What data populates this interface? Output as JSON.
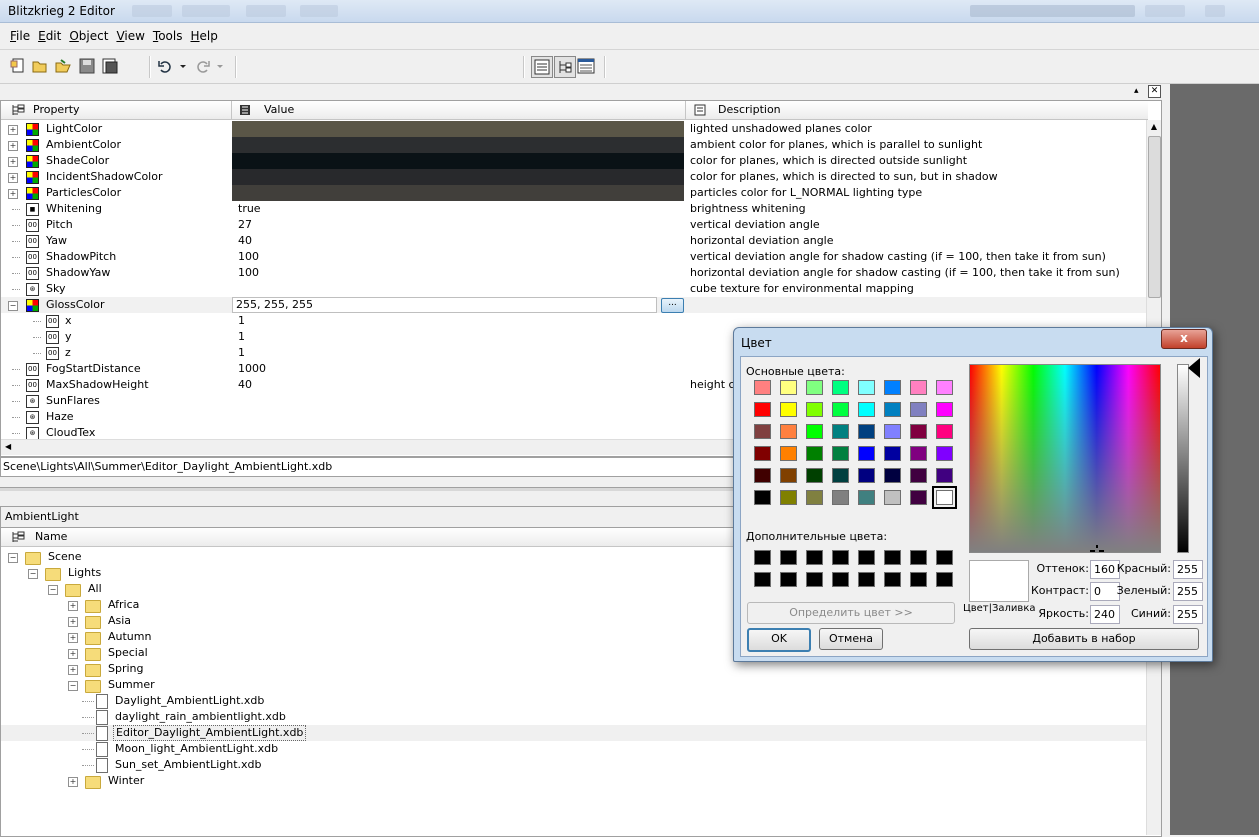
{
  "app": {
    "title": "Blitzkrieg 2 Editor"
  },
  "menu": [
    {
      "key": "F",
      "rest": "ile"
    },
    {
      "key": "E",
      "rest": "dit"
    },
    {
      "key": "O",
      "rest": "bject"
    },
    {
      "key": "V",
      "rest": "iew"
    },
    {
      "key": "T",
      "rest": "ools"
    },
    {
      "key": "H",
      "rest": "elp"
    }
  ],
  "toolbar": {
    "icons": [
      "new-icon",
      "open-icon",
      "open-folder-icon",
      "save-icon",
      "save-all-icon",
      "undo-icon",
      "undo-dropdown-icon",
      "redo-icon",
      "redo-dropdown-icon",
      "view-list-icon",
      "view-tree-icon",
      "view-table-icon"
    ]
  },
  "grid": {
    "headers": {
      "property": "Property",
      "value": "Value",
      "description": "Description"
    },
    "rows": [
      {
        "name": "LightColor",
        "value": "",
        "desc": "lighted unshadowed planes color",
        "kind": "color",
        "color": "#5a5647"
      },
      {
        "name": "AmbientColor",
        "value": "",
        "desc": "ambient color for planes, which is parallel to sunlight",
        "kind": "color",
        "color": "#2c2e30"
      },
      {
        "name": "ShadeColor",
        "value": "",
        "desc": "color for planes, which is directed outside sunlight",
        "kind": "color",
        "color": "#0a1216"
      },
      {
        "name": "IncidentShadowColor",
        "value": "",
        "desc": "color for planes, which is directed to sun, but in shadow",
        "kind": "color",
        "color": "#28292c"
      },
      {
        "name": "ParticlesColor",
        "value": "",
        "desc": "particles color for L_NORMAL lighting type",
        "kind": "color",
        "color": "#413f3b"
      },
      {
        "name": "Whitening",
        "value": "true",
        "desc": "brightness whitening",
        "kind": "bool"
      },
      {
        "name": "Pitch",
        "value": "27",
        "desc": "vertical deviation angle",
        "kind": "num"
      },
      {
        "name": "Yaw",
        "value": "40",
        "desc": "horizontal deviation angle",
        "kind": "num"
      },
      {
        "name": "ShadowPitch",
        "value": "100",
        "desc": "vertical deviation angle for shadow casting (if = 100, then take it from sun)",
        "kind": "num"
      },
      {
        "name": "ShadowYaw",
        "value": "100",
        "desc": "horizontal deviation angle for shadow casting (if = 100, then take it from sun)",
        "kind": "num"
      },
      {
        "name": "Sky",
        "value": "",
        "desc": "cube texture for environmental mapping",
        "kind": "ref"
      },
      {
        "name": "GlossColor",
        "value": "255, 255, 255",
        "desc": "",
        "kind": "color-open"
      },
      {
        "name": "x",
        "value": "1",
        "desc": "",
        "kind": "sub"
      },
      {
        "name": "y",
        "value": "1",
        "desc": "",
        "kind": "sub"
      },
      {
        "name": "z",
        "value": "1",
        "desc": "",
        "kind": "sub"
      },
      {
        "name": "FogStartDistance",
        "value": "1000",
        "desc": "",
        "kind": "num"
      },
      {
        "name": "MaxShadowHeight",
        "value": "40",
        "desc": "height ca",
        "kind": "num"
      },
      {
        "name": "SunFlares",
        "value": "",
        "desc": "",
        "kind": "ref"
      },
      {
        "name": "Haze",
        "value": "",
        "desc": "",
        "kind": "ref"
      },
      {
        "name": "CloudTex",
        "value": "",
        "desc": "",
        "kind": "ref"
      }
    ],
    "browse_label": "..."
  },
  "path": "Scene\\Lights\\All\\Summer\\Editor_Daylight_AmbientLight.xdb",
  "tree": {
    "title": "AmbientLight",
    "header": "Name",
    "items": [
      {
        "label": "Scene",
        "type": "folder",
        "depth": 0,
        "exp": "-"
      },
      {
        "label": "Lights",
        "type": "folder",
        "depth": 1,
        "exp": "-"
      },
      {
        "label": "All",
        "type": "folder",
        "depth": 2,
        "exp": "-"
      },
      {
        "label": "Africa",
        "type": "folder",
        "depth": 3,
        "exp": "+"
      },
      {
        "label": "Asia",
        "type": "folder",
        "depth": 3,
        "exp": "+"
      },
      {
        "label": "Autumn",
        "type": "folder",
        "depth": 3,
        "exp": "+"
      },
      {
        "label": "Special",
        "type": "folder",
        "depth": 3,
        "exp": "+"
      },
      {
        "label": "Spring",
        "type": "folder",
        "depth": 3,
        "exp": "+"
      },
      {
        "label": "Summer",
        "type": "folder",
        "depth": 3,
        "exp": "-"
      },
      {
        "label": "Daylight_AmbientLight.xdb",
        "type": "file",
        "depth": 4,
        "exp": ""
      },
      {
        "label": "daylight_rain_ambientlight.xdb",
        "type": "file",
        "depth": 4,
        "exp": ""
      },
      {
        "label": "Editor_Daylight_AmbientLight.xdb",
        "type": "file",
        "depth": 4,
        "exp": "",
        "selected": true
      },
      {
        "label": "Moon_light_AmbientLight.xdb",
        "type": "file",
        "depth": 4,
        "exp": ""
      },
      {
        "label": "Sun_set_AmbientLight.xdb",
        "type": "file",
        "depth": 4,
        "exp": ""
      },
      {
        "label": "Winter",
        "type": "folder",
        "depth": 3,
        "exp": "+"
      }
    ]
  },
  "dialog": {
    "title": "Цвет",
    "close_label": "x",
    "basic_label": "Основные цвета:",
    "custom_label": "Дополнительные цвета:",
    "define_button": "Определить цвет >>",
    "ok_button": "OK",
    "cancel_button": "Отмена",
    "add_button": "Добавить в набор",
    "color_solid_label": "Цвет|Заливка",
    "fields": {
      "hue": {
        "label": "Оттенок:",
        "value": "160"
      },
      "sat": {
        "label": "Контраст:",
        "value": "0"
      },
      "lum": {
        "label": "Яркость:",
        "value": "240"
      },
      "red": {
        "label": "Красный:",
        "value": "255"
      },
      "green": {
        "label": "Зеленый:",
        "value": "255"
      },
      "blue": {
        "label": "Синий:",
        "value": "255"
      }
    },
    "basic_colors": [
      "#ff8080",
      "#ffff80",
      "#80ff80",
      "#00ff80",
      "#80ffff",
      "#0080ff",
      "#ff80c0",
      "#ff80ff",
      "#ff0000",
      "#ffff00",
      "#80ff00",
      "#00ff40",
      "#00ffff",
      "#0080c0",
      "#8080c0",
      "#ff00ff",
      "#804040",
      "#ff8040",
      "#00ff00",
      "#008080",
      "#004080",
      "#8080ff",
      "#800040",
      "#ff0080",
      "#800000",
      "#ff8000",
      "#008000",
      "#008040",
      "#0000ff",
      "#0000a0",
      "#800080",
      "#8000ff",
      "#400000",
      "#804000",
      "#004000",
      "#004040",
      "#000080",
      "#000040",
      "#400040",
      "#400080",
      "#000000",
      "#808000",
      "#808040",
      "#808080",
      "#408080",
      "#c0c0c0",
      "#400040",
      "#ffffff"
    ],
    "selected_swatch": 47
  }
}
